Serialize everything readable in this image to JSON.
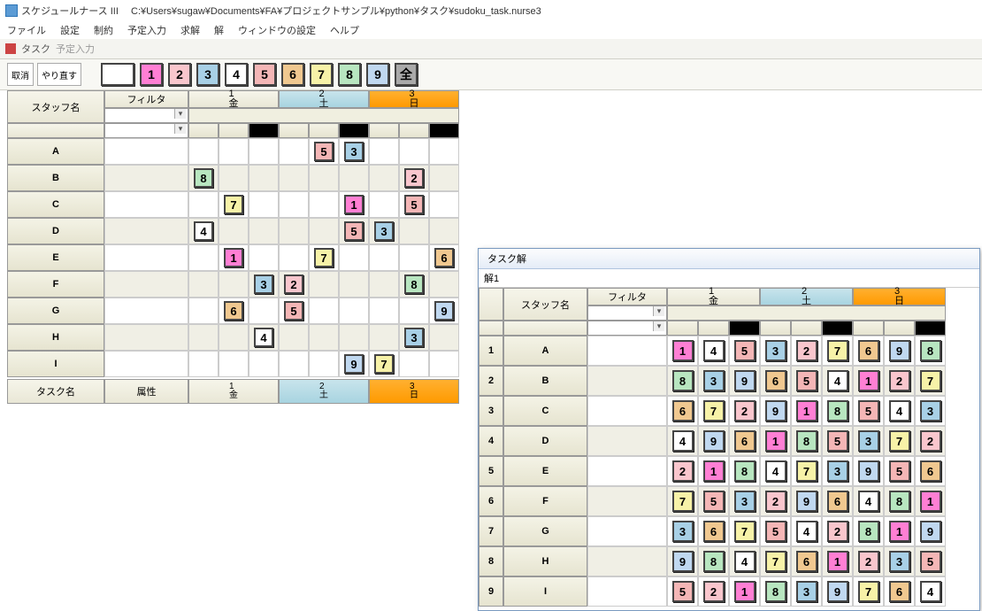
{
  "app": {
    "title": "スケジュールナース III",
    "file_path": "C:¥Users¥sugaw¥Documents¥FA¥プロジェクトサンプル¥python¥タスク¥sudoku_task.nurse3"
  },
  "menu": [
    "ファイル",
    "設定",
    "制約",
    "予定入力",
    "求解",
    "解",
    "ウィンドウの設定",
    "ヘルプ"
  ],
  "doc_tabs": [
    "タスク",
    "予定入力"
  ],
  "toolbar": {
    "undo": "取消",
    "redo": "やり直す",
    "palette": [
      {
        "label": "",
        "cls": "c-blank"
      },
      {
        "label": "1",
        "cls": "c1"
      },
      {
        "label": "2",
        "cls": "c2"
      },
      {
        "label": "3",
        "cls": "c3"
      },
      {
        "label": "4",
        "cls": "c4"
      },
      {
        "label": "5",
        "cls": "c5"
      },
      {
        "label": "6",
        "cls": "c6"
      },
      {
        "label": "7",
        "cls": "c7"
      },
      {
        "label": "8",
        "cls": "c8"
      },
      {
        "label": "9",
        "cls": "c9"
      },
      {
        "label": "全",
        "cls": "cA"
      }
    ]
  },
  "left": {
    "staff_header": "スタッフ名",
    "filter_header": "フィルタ",
    "days": [
      {
        "num": "1",
        "wd": "金",
        "cls": "d1"
      },
      {
        "num": "2",
        "wd": "土",
        "cls": "d2"
      },
      {
        "num": "3",
        "wd": "日",
        "cls": "d3"
      }
    ],
    "mini_pattern": [
      "",
      "",
      "blk",
      "",
      "",
      "blk",
      "",
      "",
      "blk"
    ],
    "rows": [
      {
        "label": "A",
        "cells": [
          "",
          "",
          "",
          "",
          "5",
          "3",
          "",
          "",
          ""
        ]
      },
      {
        "label": "B",
        "cells": [
          "8",
          "",
          "",
          "",
          "",
          "",
          "",
          "2",
          ""
        ]
      },
      {
        "label": "C",
        "cells": [
          "",
          "7",
          "",
          "",
          "",
          "1",
          "",
          "5",
          ""
        ]
      },
      {
        "label": "D",
        "cells": [
          "4",
          "",
          "",
          "",
          "",
          "5",
          "3",
          "",
          ""
        ]
      },
      {
        "label": "E",
        "cells": [
          "",
          "1",
          "",
          "",
          "7",
          "",
          "",
          "",
          "6"
        ]
      },
      {
        "label": "F",
        "cells": [
          "",
          "",
          "3",
          "2",
          "",
          "",
          "",
          "8",
          ""
        ]
      },
      {
        "label": "G",
        "cells": [
          "",
          "6",
          "",
          "5",
          "",
          "",
          "",
          "",
          "9"
        ]
      },
      {
        "label": "H",
        "cells": [
          "",
          "",
          "4",
          "",
          "",
          "",
          "",
          "3",
          ""
        ]
      },
      {
        "label": "I",
        "cells": [
          "",
          "",
          "",
          "",
          "",
          "9",
          "7",
          "",
          ""
        ]
      }
    ],
    "lower": {
      "task_header": "タスク名",
      "attr_header": "属性"
    }
  },
  "solution": {
    "window_title": "タスク解",
    "tab": "解1",
    "staff_header": "スタッフ名",
    "filter_header": "フィルタ",
    "days": [
      {
        "num": "1",
        "wd": "金",
        "cls": "d1"
      },
      {
        "num": "2",
        "wd": "土",
        "cls": "d2"
      },
      {
        "num": "3",
        "wd": "日",
        "cls": "d3"
      }
    ],
    "mini_pattern": [
      "",
      "",
      "blk",
      "",
      "",
      "blk",
      "",
      "",
      "blk"
    ],
    "rows": [
      {
        "n": "1",
        "label": "A",
        "cells": [
          "1",
          "4",
          "5",
          "3",
          "2",
          "7",
          "6",
          "9",
          "8"
        ]
      },
      {
        "n": "2",
        "label": "B",
        "cells": [
          "8",
          "3",
          "9",
          "6",
          "5",
          "4",
          "1",
          "2",
          "7"
        ]
      },
      {
        "n": "3",
        "label": "C",
        "cells": [
          "6",
          "7",
          "2",
          "9",
          "1",
          "8",
          "5",
          "4",
          "3"
        ]
      },
      {
        "n": "4",
        "label": "D",
        "cells": [
          "4",
          "9",
          "6",
          "1",
          "8",
          "5",
          "3",
          "7",
          "2"
        ]
      },
      {
        "n": "5",
        "label": "E",
        "cells": [
          "2",
          "1",
          "8",
          "4",
          "7",
          "3",
          "9",
          "5",
          "6"
        ]
      },
      {
        "n": "6",
        "label": "F",
        "cells": [
          "7",
          "5",
          "3",
          "2",
          "9",
          "6",
          "4",
          "8",
          "1"
        ]
      },
      {
        "n": "7",
        "label": "G",
        "cells": [
          "3",
          "6",
          "7",
          "5",
          "4",
          "2",
          "8",
          "1",
          "9"
        ]
      },
      {
        "n": "8",
        "label": "H",
        "cells": [
          "9",
          "8",
          "4",
          "7",
          "6",
          "1",
          "2",
          "3",
          "5"
        ]
      },
      {
        "n": "9",
        "label": "I",
        "cells": [
          "5",
          "2",
          "1",
          "8",
          "3",
          "9",
          "7",
          "6",
          "4"
        ]
      }
    ]
  },
  "tile_class_map": {
    "1": "c1",
    "2": "c2",
    "3": "c3",
    "4": "c4",
    "5": "c5",
    "6": "c6",
    "7": "c7",
    "8": "c8",
    "9": "c9"
  }
}
